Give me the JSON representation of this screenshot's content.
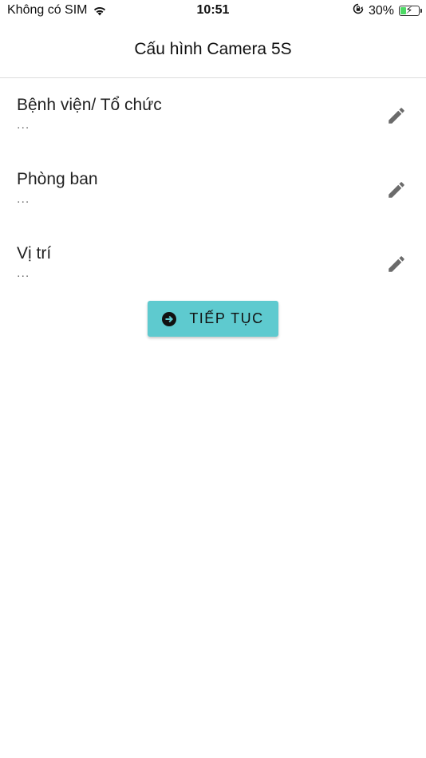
{
  "status_bar": {
    "carrier": "Không có SIM",
    "time": "10:51",
    "battery_percent": "30%",
    "battery_level": 0.3,
    "icons": [
      "wifi-icon",
      "orientation-lock-icon",
      "battery-charging-icon"
    ]
  },
  "header": {
    "title": "Cấu hình Camera 5S"
  },
  "settings": [
    {
      "label": "Bệnh viện/ Tổ chức",
      "value": "...",
      "icon": "pencil-icon"
    },
    {
      "label": "Phòng ban",
      "value": "...",
      "icon": "pencil-icon"
    },
    {
      "label": "Vị trí",
      "value": "...",
      "icon": "pencil-icon"
    }
  ],
  "continue_button": {
    "label": "TIẾP TỤC",
    "icon": "arrow-circle-right-icon",
    "color": "#5ecacf"
  }
}
